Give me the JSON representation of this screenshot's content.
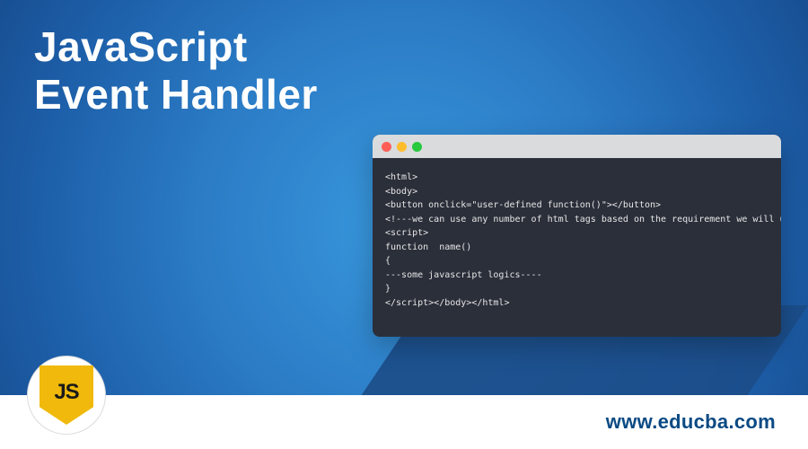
{
  "title": {
    "line1": "JavaScript",
    "line2": "Event Handler"
  },
  "code_window": {
    "lines": [
      "<html>",
      "<body>",
      "<button onclick=\"user-defined function()\"></button>",
      "<!---we can use any number of html tags based on the requirement we will use the tags for developing the UI page--->",
      "<script>",
      "function  name()",
      "{",
      "---some javascript logics----",
      "}",
      "</script></body></html>"
    ]
  },
  "logo": {
    "text": "JS"
  },
  "footer": {
    "url": "www.educba.com"
  },
  "colors": {
    "bg_center": "#3999de",
    "bg_edge": "#184f92",
    "code_bg": "#2b2f3a",
    "titlebar": "#d9dbdd",
    "js_yellow": "#f0b90b",
    "footer_bg": "#ffffff",
    "footer_text": "#0a4a84"
  }
}
